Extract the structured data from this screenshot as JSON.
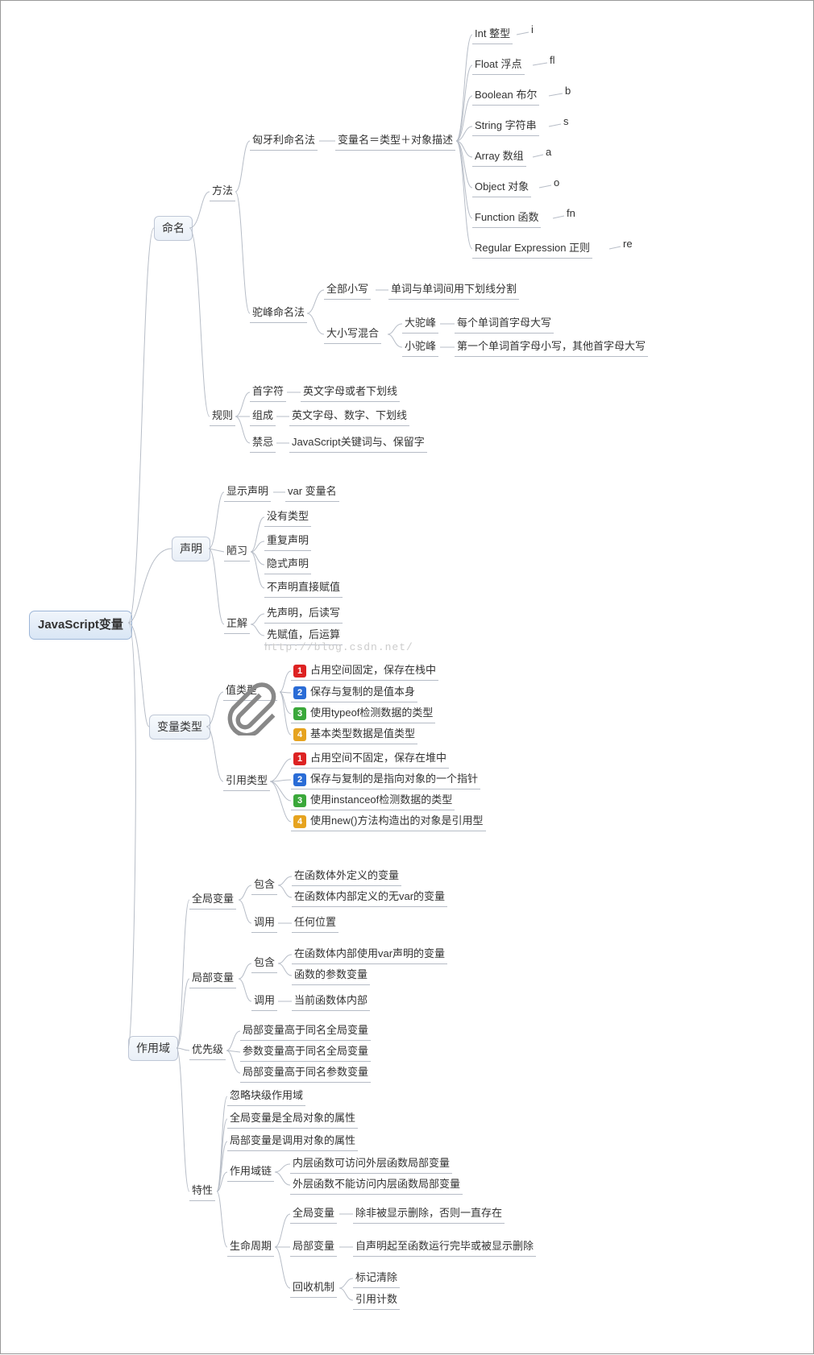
{
  "root": "JavaScript变量",
  "watermark": "http://blog.csdn.net/",
  "naming": {
    "label": "命名",
    "method": {
      "label": "方法",
      "hungarian": {
        "label": "匈牙利命名法",
        "rule": "变量名＝类型＋对象描述",
        "types": {
          "int": {
            "name": "Int 整型",
            "code": "i"
          },
          "float": {
            "name": "Float 浮点",
            "code": "fl"
          },
          "bool": {
            "name": "Boolean 布尔",
            "code": "b"
          },
          "string": {
            "name": "String 字符串",
            "code": "s"
          },
          "array": {
            "name": "Array 数组",
            "code": "a"
          },
          "object": {
            "name": "Object 对象",
            "code": "o"
          },
          "func": {
            "name": "Function 函数",
            "code": "fn"
          },
          "regex": {
            "name": "Regular Expression 正则",
            "code": "re"
          }
        }
      },
      "camel": {
        "label": "驼峰命名法",
        "all_lower": {
          "label": "全部小写",
          "desc": "单词与单词间用下划线分割"
        },
        "mix": {
          "label": "大小写混合",
          "big": {
            "label": "大驼峰",
            "desc": "每个单词首字母大写"
          },
          "small": {
            "label": "小驼峰",
            "desc": "第一个单词首字母小写，其他首字母大写"
          }
        }
      }
    },
    "rule": {
      "label": "规则",
      "first": {
        "label": "首字符",
        "desc": "英文字母或者下划线"
      },
      "compose": {
        "label": "组成",
        "desc": "英文字母、数字、下划线"
      },
      "forbid": {
        "label": "禁忌",
        "desc": "JavaScript关键词与、保留字"
      }
    }
  },
  "declare": {
    "label": "声明",
    "explicit": {
      "label": "显示声明",
      "desc": "var 变量名"
    },
    "bad": {
      "label": "陋习",
      "a": "没有类型",
      "b": "重复声明",
      "c": "隐式声明",
      "d": "不声明直接赋值"
    },
    "good": {
      "label": "正解",
      "a": "先声明，后读写",
      "b": "先赋值，后运算"
    }
  },
  "vartype": {
    "label": "变量类型",
    "value": {
      "label": "值类型",
      "a": "占用空间固定，保存在栈中",
      "b": "保存与复制的是值本身",
      "c": "使用typeof检测数据的类型",
      "d": "基本类型数据是值类型"
    },
    "ref": {
      "label": "引用类型",
      "a": "占用空间不固定，保存在堆中",
      "b": "保存与复制的是指向对象的一个指针",
      "c": "使用instanceof检测数据的类型",
      "d": "使用new()方法构造出的对象是引用型"
    }
  },
  "scope": {
    "label": "作用域",
    "global": {
      "label": "全局变量",
      "contain": {
        "label": "包含",
        "a": "在函数体外定义的变量",
        "b": "在函数体内部定义的无var的变量"
      },
      "call": {
        "label": "调用",
        "a": "任何位置"
      }
    },
    "local": {
      "label": "局部变量",
      "contain": {
        "label": "包含",
        "a": "在函数体内部使用var声明的变量",
        "b": "函数的参数变量"
      },
      "call": {
        "label": "调用",
        "a": "当前函数体内部"
      }
    },
    "priority": {
      "label": "优先级",
      "a": "局部变量高于同名全局变量",
      "b": "参数变量高于同名全局变量",
      "c": "局部变量高于同名参数变量"
    },
    "trait": {
      "label": "特性",
      "a": "忽略块级作用域",
      "b": "全局变量是全局对象的属性",
      "c": "局部变量是调用对象的属性",
      "chain": {
        "label": "作用域链",
        "a": "内层函数可访问外层函数局部变量",
        "b": "外层函数不能访问内层函数局部变量"
      },
      "life": {
        "label": "生命周期",
        "global": {
          "label": "全局变量",
          "desc": "除非被显示删除，否则一直存在"
        },
        "local": {
          "label": "局部变量",
          "desc": "自声明起至函数运行完毕或被显示删除"
        },
        "gc": {
          "label": "回收机制",
          "a": "标记清除",
          "b": "引用计数"
        }
      }
    }
  }
}
